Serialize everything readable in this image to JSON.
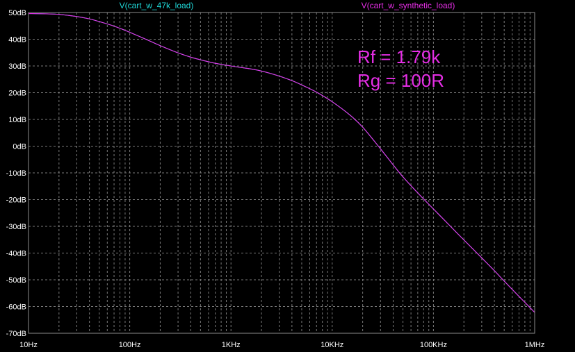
{
  "colors": {
    "background": "#000000",
    "frame": "#8c8c8c",
    "grid": "#7a7a7a",
    "tick_text": "#ffffff",
    "series_1": "#1fd6d6",
    "series_2": "#e62ee6",
    "annotation": "#e62ee6"
  },
  "chart_data": {
    "type": "line",
    "title": "",
    "xlabel": "",
    "ylabel": "",
    "x_scale": "log",
    "xlim": [
      10,
      1000000
    ],
    "ylim": [
      -70,
      50
    ],
    "grid": true,
    "x_ticks": [
      {
        "value": 10,
        "label": "10Hz"
      },
      {
        "value": 100,
        "label": "100Hz"
      },
      {
        "value": 1000,
        "label": "1KHz"
      },
      {
        "value": 10000,
        "label": "10KHz"
      },
      {
        "value": 100000,
        "label": "100KHz"
      },
      {
        "value": 1000000,
        "label": "1MHz"
      }
    ],
    "y_ticks": [
      {
        "value": 50,
        "label": "50dB"
      },
      {
        "value": 40,
        "label": "40dB"
      },
      {
        "value": 30,
        "label": "30dB"
      },
      {
        "value": 20,
        "label": "20dB"
      },
      {
        "value": 10,
        "label": "10dB"
      },
      {
        "value": 0,
        "label": "0dB"
      },
      {
        "value": -10,
        "label": "-10dB"
      },
      {
        "value": -20,
        "label": "-20dB"
      },
      {
        "value": -30,
        "label": "-30dB"
      },
      {
        "value": -40,
        "label": "-40dB"
      },
      {
        "value": -50,
        "label": "-50dB"
      },
      {
        "value": -60,
        "label": "-60dB"
      },
      {
        "value": -70,
        "label": "-70dB"
      }
    ],
    "x": [
      10,
      15,
      20,
      30,
      40,
      50,
      70,
      100,
      150,
      200,
      300,
      400,
      500,
      700,
      1000,
      1500,
      2000,
      3000,
      4000,
      5000,
      7000,
      10000,
      15000,
      20000,
      30000,
      40000,
      50000,
      70000,
      100000,
      150000,
      200000,
      300000,
      400000,
      500000,
      700000,
      1000000
    ],
    "series": [
      {
        "name": "V(cart_w_47k_load)",
        "color": "#1fd6d6",
        "values": [
          49.6,
          49.5,
          49.3,
          48.5,
          47.6,
          46.6,
          44.9,
          42.6,
          39.7,
          37.6,
          34.9,
          33.3,
          32.3,
          31.0,
          30.0,
          29.0,
          28.1,
          26.2,
          24.5,
          22.9,
          20.2,
          16.6,
          11.6,
          7.1,
          -1.0,
          -7.0,
          -11.5,
          -17.5,
          -23.5,
          -30.3,
          -35.1,
          -41.8,
          -46.6,
          -50.5,
          -56.2,
          -62.2
        ]
      },
      {
        "name": "V(cart_w_synthetic_load)",
        "color": "#e62ee6",
        "values": [
          49.6,
          49.5,
          49.3,
          48.5,
          47.6,
          46.6,
          44.9,
          42.6,
          39.7,
          37.6,
          34.9,
          33.3,
          32.3,
          31.0,
          30.0,
          29.0,
          28.1,
          26.2,
          24.5,
          22.9,
          20.2,
          16.6,
          11.6,
          7.1,
          -1.0,
          -7.0,
          -11.5,
          -17.5,
          -23.5,
          -30.3,
          -35.1,
          -41.8,
          -46.6,
          -50.5,
          -56.2,
          -62.2
        ]
      }
    ],
    "annotations": [
      "Rf = 1.79k",
      "Rg = 100R"
    ]
  }
}
